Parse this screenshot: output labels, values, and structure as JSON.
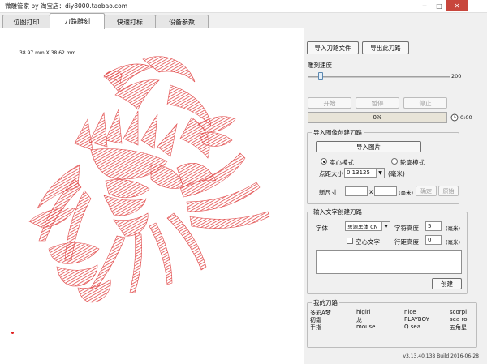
{
  "window": {
    "title": "微雕管家 by 淘宝店：diy8000.taobao.com",
    "min_label": "─",
    "max_label": "□",
    "close_label": "✕"
  },
  "tabs": [
    {
      "label": "位图打印"
    },
    {
      "label": "刀路雕刻"
    },
    {
      "label": "快速打标"
    },
    {
      "label": "设备参数"
    }
  ],
  "canvas": {
    "dimensions": "38.97 mm X 38.62 mm",
    "stroke_color": "#e24b4b"
  },
  "panel": {
    "import_path_button": "导入刀路文件",
    "export_path_button": "导出此刀路",
    "speed_label": "雕刻速度",
    "speed_max": "200",
    "speed_value": 17,
    "start_button": "开始",
    "pause_button": "暂停",
    "stop_button": "停止",
    "progress_text": "0%",
    "elapsed_time": "0:00",
    "image_group": {
      "legend": "导入图像创建刀路",
      "import_image_button": "导入图片",
      "mode_solid": "实心模式",
      "mode_outline": "轮廓模式",
      "dot_size_label": "点距大小",
      "dot_size_value": "0.13125",
      "dot_size_unit": "(毫米)",
      "new_size_label": "新尺寸",
      "size_x": "x",
      "size_unit": "(毫米)",
      "confirm_button": "确定",
      "original_button": "原始"
    },
    "text_group": {
      "legend": "输入文字创建刀路",
      "font_label": "字体",
      "font_value": "思源黑体 CN",
      "char_height_label": "字符高度",
      "char_height_value": "5",
      "char_height_unit": "(毫米)",
      "hollow_label": "空心文字",
      "line_height_label": "行距高度",
      "line_height_value": "0",
      "line_height_unit": "(毫米)",
      "create_button": "创建"
    },
    "my_paths": {
      "legend": "我的刀路",
      "rows": [
        [
          "多彩A梦",
          "higirl",
          "nice",
          "scorpi"
        ],
        [
          "初霜",
          "龙",
          "PLAYBOY",
          "sea ro"
        ],
        [
          "手指",
          "mouse",
          "Q sea",
          "五角星"
        ]
      ]
    },
    "version": "v3.13.40.138 Build 2016-06-28"
  }
}
